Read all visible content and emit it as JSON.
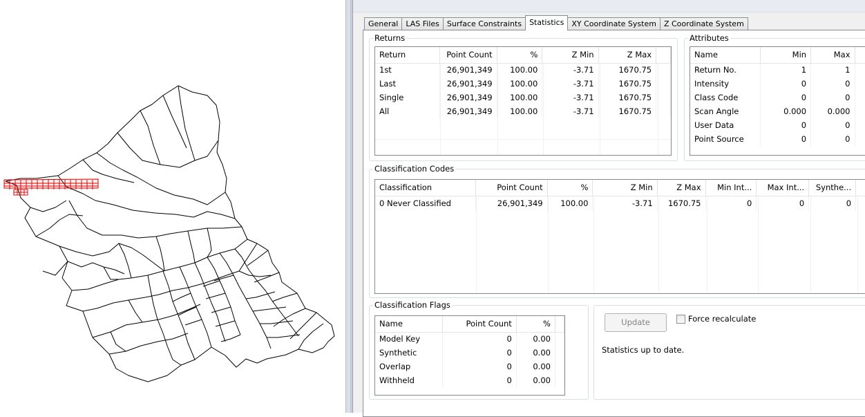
{
  "map": {
    "icon": "oahu-district-map"
  },
  "tabs": [
    {
      "label": "General"
    },
    {
      "label": "LAS Files"
    },
    {
      "label": "Surface Constraints"
    },
    {
      "label": "Statistics"
    },
    {
      "label": "XY Coordinate System"
    },
    {
      "label": "Z Coordinate System"
    }
  ],
  "returns": {
    "title": "Returns",
    "columns": [
      "Return",
      "Point Count",
      "%",
      "Z Min",
      "Z Max"
    ],
    "rows": [
      [
        "1st",
        "26,901,349",
        "100.00",
        "-3.71",
        "1670.75"
      ],
      [
        "Last",
        "26,901,349",
        "100.00",
        "-3.71",
        "1670.75"
      ],
      [
        "Single",
        "26,901,349",
        "100.00",
        "-3.71",
        "1670.75"
      ],
      [
        "All",
        "26,901,349",
        "100.00",
        "-3.71",
        "1670.75"
      ]
    ]
  },
  "attributes": {
    "title": "Attributes",
    "columns": [
      "Name",
      "Min",
      "Max"
    ],
    "rows": [
      [
        "Return No.",
        "1",
        "1"
      ],
      [
        "Intensity",
        "0",
        "0"
      ],
      [
        "Class Code",
        "0",
        "0"
      ],
      [
        "Scan Angle",
        "0.000",
        "0.000"
      ],
      [
        "User Data",
        "0",
        "0"
      ],
      [
        "Point Source",
        "0",
        "0"
      ]
    ]
  },
  "classification_codes": {
    "title": "Classification Codes",
    "columns": [
      "Classification",
      "Point Count",
      "%",
      "Z Min",
      "Z Max",
      "Min Int...",
      "Max Int...",
      "Synthe..."
    ],
    "rows": [
      [
        "0  Never Classified",
        "26,901,349",
        "100.00",
        "-3.71",
        "1670.75",
        "0",
        "0",
        "0"
      ]
    ]
  },
  "classification_flags": {
    "title": "Classification Flags",
    "columns": [
      "Name",
      "Point Count",
      "%"
    ],
    "rows": [
      [
        "Model Key",
        "0",
        "0.00"
      ],
      [
        "Synthetic",
        "0",
        "0.00"
      ],
      [
        "Overlap",
        "0",
        "0.00"
      ],
      [
        "Withheld",
        "0",
        "0.00"
      ]
    ]
  },
  "update": {
    "button_label": "Update",
    "force_label": "Force recalculate",
    "force_checked": false,
    "status": "Statistics up to date."
  }
}
